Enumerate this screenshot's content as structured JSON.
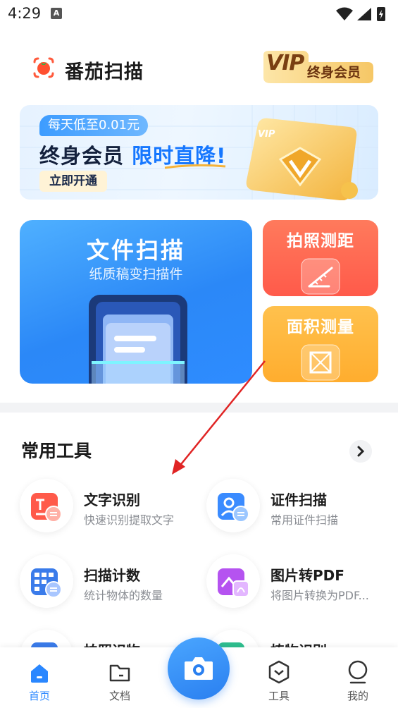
{
  "status_bar": {
    "time": "4:29",
    "notification_letter": "A"
  },
  "header": {
    "app_name": "番茄扫描",
    "vip_text": "VIP",
    "vip_label": "终身会员"
  },
  "banner": {
    "tag": "每天低至0.01元",
    "title_main": "终身会员",
    "title_accent": "限时直降!",
    "button_label": "立即开通",
    "card_text": "VIP"
  },
  "features": {
    "scan": {
      "title": "文件扫描",
      "subtitle": "纸质稿变扫描件"
    },
    "distance": {
      "title": "拍照测距"
    },
    "area": {
      "title": "面积测量"
    }
  },
  "tools_section": {
    "title": "常用工具",
    "items": [
      {
        "name": "文字识别",
        "desc": "快速识别提取文字",
        "icon": "text-recognition-icon"
      },
      {
        "name": "证件扫描",
        "desc": "常用证件扫描",
        "icon": "id-scan-icon"
      },
      {
        "name": "扫描计数",
        "desc": "统计物体的数量",
        "icon": "counting-icon"
      },
      {
        "name": "图片转PDF",
        "desc": "将图片转换为PDF...",
        "icon": "image-to-pdf-icon"
      },
      {
        "name": "拍照识物",
        "desc": "",
        "icon": "object-recognition-icon"
      },
      {
        "name": "植物识别",
        "desc": "",
        "icon": "plant-recognition-icon"
      }
    ]
  },
  "bottom_nav": {
    "items": [
      {
        "label": "首页",
        "active": true,
        "icon": "home-icon"
      },
      {
        "label": "文档",
        "active": false,
        "icon": "folder-icon"
      },
      {
        "label": "工具",
        "active": false,
        "icon": "tools-icon"
      },
      {
        "label": "我的",
        "active": false,
        "icon": "profile-icon"
      }
    ],
    "camera_icon": "camera-icon"
  },
  "colors": {
    "primary": "#2a87ff",
    "vip_gold": "#f7c96b",
    "distance_card": "#ff6350",
    "area_card": "#ffb53a",
    "annotation_arrow": "#e02424"
  }
}
